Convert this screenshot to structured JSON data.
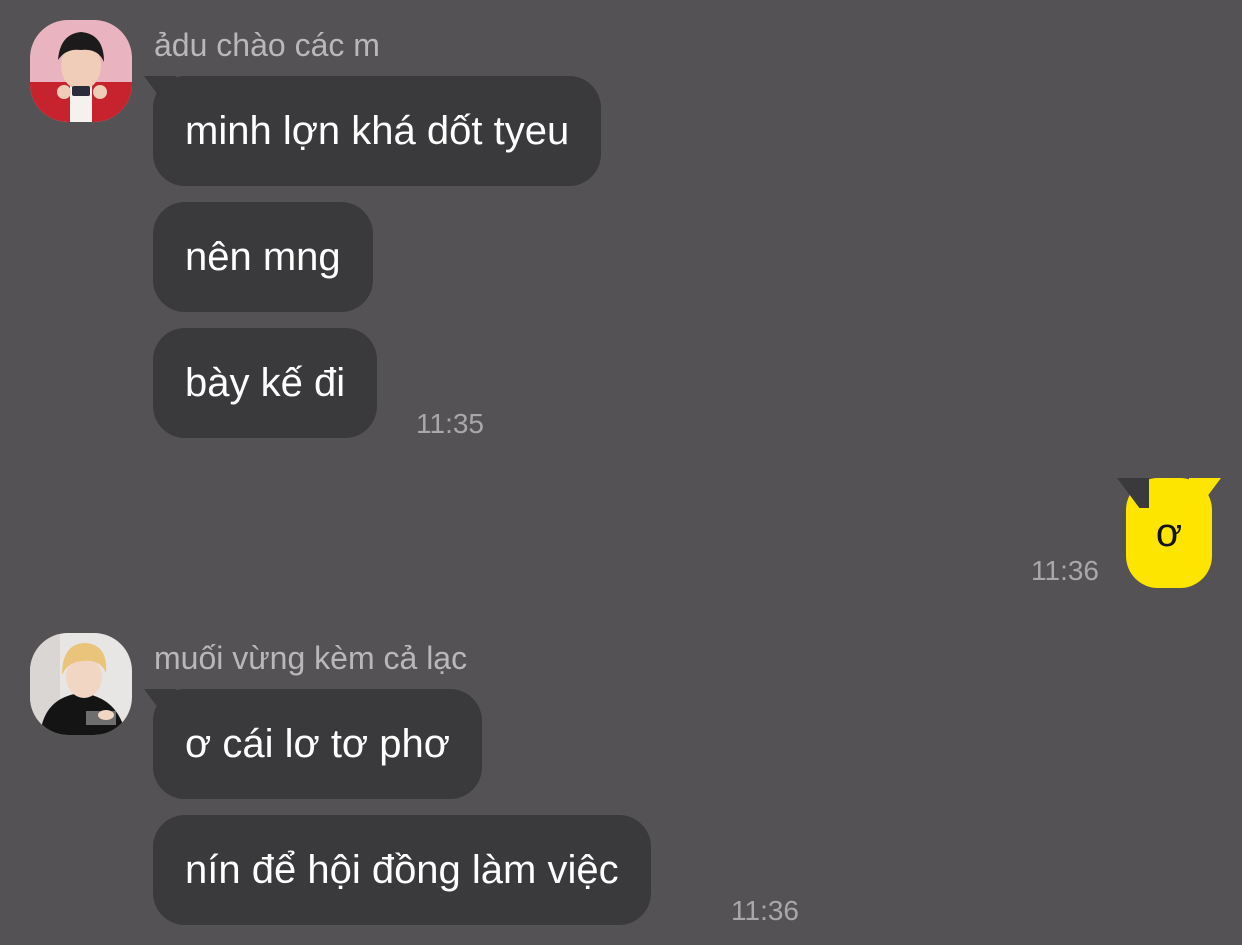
{
  "chat": {
    "groups": [
      {
        "sender": "ảdu chào các m",
        "messages": [
          "minh lợn khá dốt tyeu",
          "nên mng",
          "bày kế đi"
        ],
        "time": "11:35"
      },
      {
        "mine": true,
        "messages": [
          "ơ"
        ],
        "time": "11:36"
      },
      {
        "sender": "muối vừng kèm cả lạc",
        "messages": [
          "ơ cái lơ tơ phơ",
          "nín để hội đồng làm việc"
        ],
        "time": "11:36"
      }
    ]
  },
  "colors": {
    "background": "#545254",
    "bubble_incoming": "#3a393b",
    "bubble_outgoing": "#fee500",
    "name_text": "#b9b7b9",
    "time_text": "#a9a7a9"
  }
}
